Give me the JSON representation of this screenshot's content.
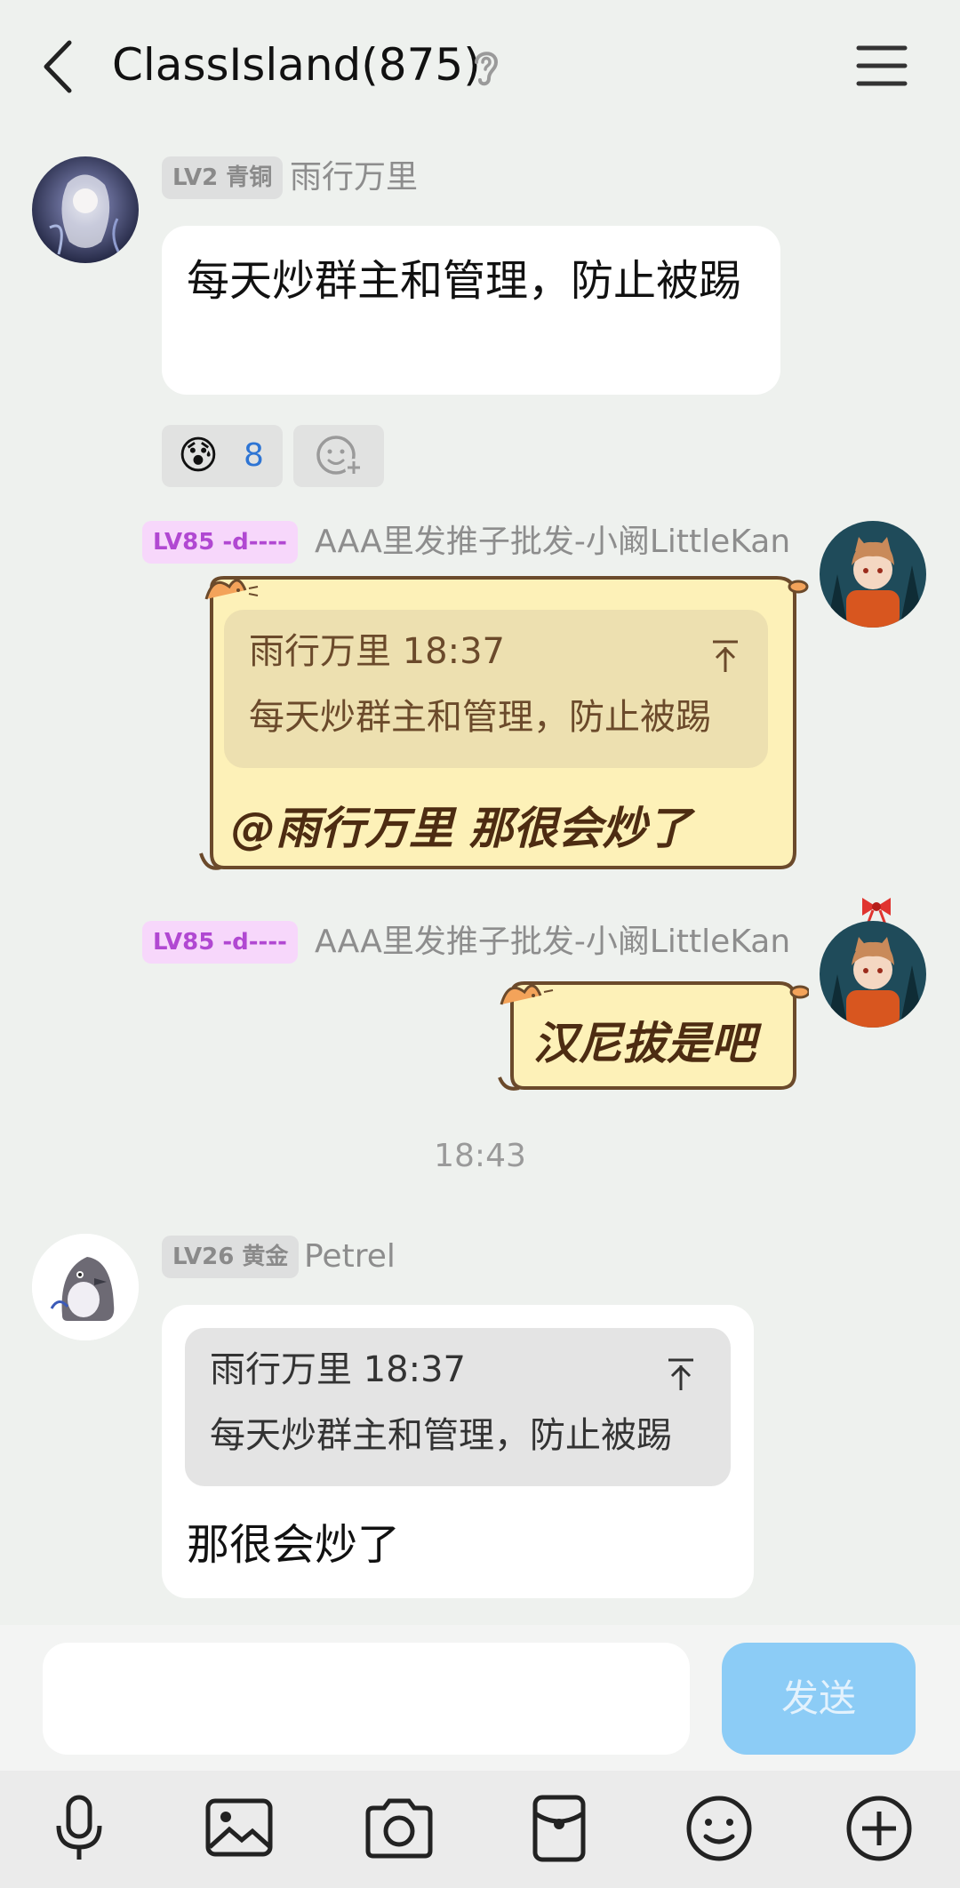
{
  "header": {
    "title": "ClassIsland(875)"
  },
  "messages": {
    "m1": {
      "badge": "LV2 青铜",
      "sender": "雨行万里",
      "text": "每天炒群主和管理，防止被踢",
      "reaction_emoji": "😰",
      "reaction_count": "8"
    },
    "m2": {
      "badge": "LV85 -d----",
      "sender": "AAA里发推子批发-小阚LittleKan",
      "quote_head": "雨行万里 18:37",
      "quote_text": "每天炒群主和管理，防止被踢",
      "text": "@雨行万里 那很会炒了"
    },
    "m3": {
      "badge": "LV85 -d----",
      "sender": "AAA里发推子批发-小阚LittleKan",
      "text": "汉尼拔是吧"
    },
    "time_separator": "18:43",
    "m4": {
      "badge": "LV26 黄金",
      "sender": "Petrel",
      "quote_head": "雨行万里 18:37",
      "quote_text": "每天炒群主和管理，防止被踢",
      "text": "那很会炒了"
    }
  },
  "input": {
    "value": "",
    "placeholder": "",
    "send_label": "发送"
  },
  "toolbar": [
    "mic-icon",
    "image-icon",
    "camera-icon",
    "red-packet-icon",
    "emoji-icon",
    "plus-icon"
  ],
  "colors": {
    "background": "#eef1ee",
    "send_button": "#8cccf6",
    "cat_bubble": "#fdf1b8",
    "cat_border": "#6b4a2b",
    "link_blue": "#2e75d4"
  }
}
